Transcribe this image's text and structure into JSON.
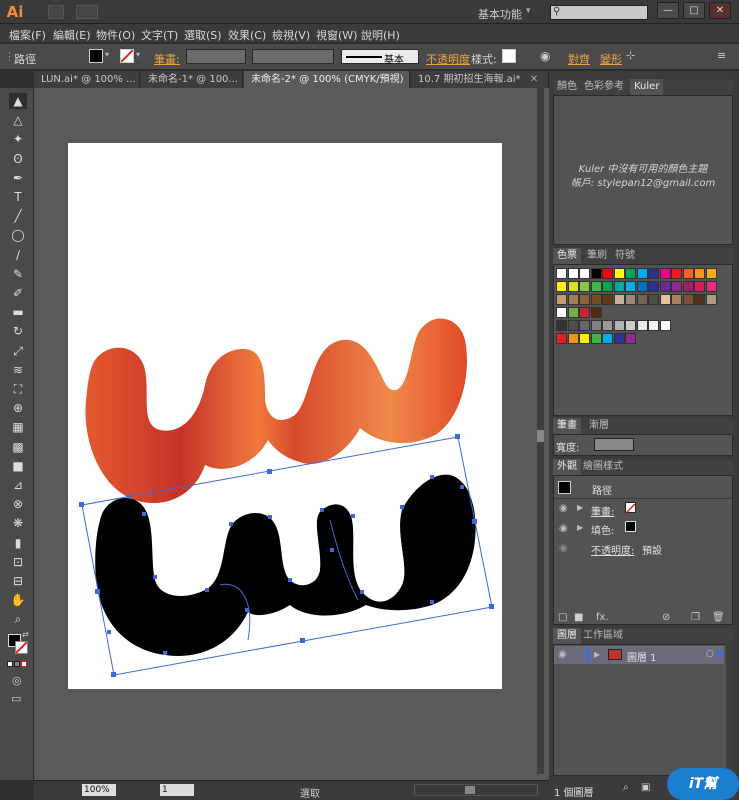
{
  "app": {
    "logo": "Ai",
    "workspace": "基本功能",
    "workspace_caret": "▾"
  },
  "window_controls": [
    "—",
    "□",
    "✕"
  ],
  "menus": [
    "檔案(F)",
    "編輯(E)",
    "物件(O)",
    "文字(T)",
    "選取(S)",
    "效果(C)",
    "檢視(V)",
    "視窗(W)",
    "說明(H)"
  ],
  "control_bar": {
    "object_type": "路徑",
    "stroke_label": "筆畫:",
    "stroke_style": "基本",
    "opacity_label": "不透明度",
    "style_label": "樣式:",
    "align_label": "對齊",
    "transform_label": "變形"
  },
  "tabs": [
    {
      "label": "LUN.ai* @ 100% ...",
      "close": "✕"
    },
    {
      "label": "未命名-1* @ 100...",
      "close": "✕"
    },
    {
      "label": "未命名-2* @ 100% (CMYK/預視)",
      "close": "✕"
    },
    {
      "label": "10.7 期初招生海報.ai*",
      "close": "✕"
    }
  ],
  "tools": [
    "selection-tool",
    "direct-selection-tool",
    "magic-wand-tool",
    "lasso-tool",
    "pen-tool",
    "type-tool",
    "line-tool",
    "ellipse-tool",
    "paintbrush-tool",
    "pencil-tool",
    "blob-brush-tool",
    "eraser-tool",
    "rotate-tool",
    "scale-tool",
    "width-tool",
    "free-transform-tool",
    "shape-builder-tool",
    "perspective-grid-tool",
    "mesh-tool",
    "gradient-tool",
    "eyedropper-tool",
    "blend-tool",
    "symbol-sprayer-tool",
    "column-graph-tool",
    "artboard-tool",
    "slice-tool",
    "hand-tool",
    "zoom-tool"
  ],
  "tool_glyphs": [
    "▲",
    "△",
    "✦",
    "ʘ",
    "✒",
    "T",
    "╱",
    "◯",
    "∕",
    "✎",
    "✐",
    "▬",
    "↻",
    "⤢",
    "≋",
    "⛶",
    "⊕",
    "▦",
    "▩",
    "■",
    "⊿",
    "⊗",
    "❋",
    "▮",
    "⊡",
    "⊟",
    "✋",
    "⌕"
  ],
  "color_tools": {
    "swap": "⇄",
    "reset": "◪"
  },
  "status": {
    "zoom": "100%",
    "page": "1",
    "mode": "選取"
  },
  "kuler": {
    "tabs": [
      "顏色",
      "色彩參考",
      "Kuler"
    ],
    "message_line1": "Kuler 中沒有可用的顏色主題",
    "message_line2": "帳戶: stylepan12@gmail.com"
  },
  "swatches_panel": {
    "tabs": [
      "色票",
      "筆刷",
      "符號"
    ]
  },
  "stroke_panel": {
    "tabs": [
      "筆畫",
      "漸層"
    ],
    "width_label": "寬度:"
  },
  "appearance_panel": {
    "tabs": [
      "外觀",
      "繪圖樣式"
    ],
    "title": "路徑",
    "rows": [
      {
        "label": "筆畫:",
        "value": ""
      },
      {
        "label": "填色:",
        "value": ""
      },
      {
        "label": "不透明度:",
        "value": "預設"
      }
    ],
    "fx": "fx."
  },
  "layers_panel": {
    "tabs": [
      "圖層",
      "工作區域"
    ],
    "layer_name": "圖層 1",
    "footer": "1 個圖層"
  },
  "watermark": "iT幫",
  "colors": {
    "accent_orange": "#f2a341",
    "selection_blue": "#3f69d6",
    "gradient_light": "#f07a3c",
    "gradient_dark": "#c6322a"
  }
}
